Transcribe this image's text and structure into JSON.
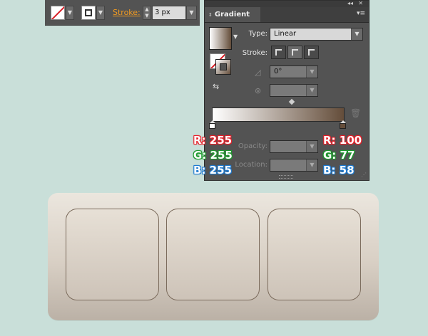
{
  "toolbar": {
    "stroke_label": "Stroke:",
    "stroke_weight": "3 px"
  },
  "gradient_panel": {
    "title": "Gradient",
    "type_label": "Type:",
    "type_value": "Linear",
    "stroke_label": "Stroke:",
    "angle_value": "0°",
    "aspect_value": "",
    "opacity_label": "Opacity:",
    "opacity_value": "",
    "location_label": "Location:",
    "location_value": "",
    "start_color": "#ffffff",
    "end_color": "#644d3a"
  },
  "color_stops": {
    "left": {
      "r": "R: 255",
      "g": "G: 255",
      "b": "B: 255"
    },
    "right": {
      "r": "R: 100",
      "g": "G: 77",
      "b": "B: 58"
    }
  },
  "artwork": {
    "plate_top_color": "#ebe6de",
    "plate_bottom_color": "#bbb1a6",
    "key_count": 3
  }
}
